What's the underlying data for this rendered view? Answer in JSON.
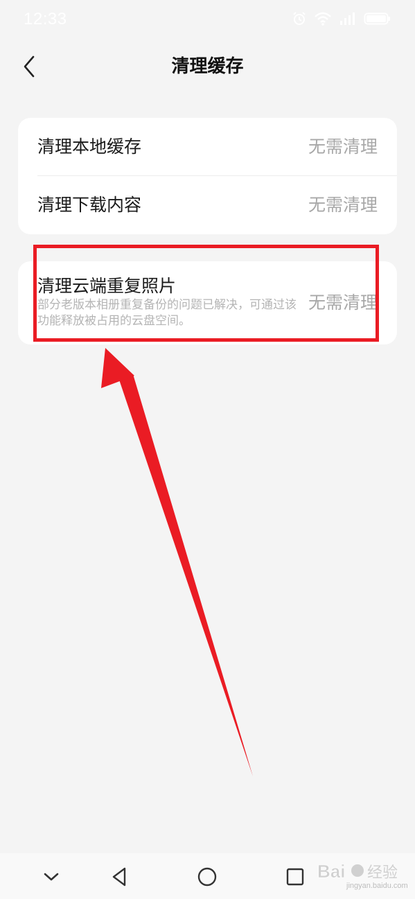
{
  "status_bar": {
    "time": "12:33",
    "icons": [
      "alarm-icon",
      "wifi-icon",
      "signal-icon",
      "battery-icon"
    ]
  },
  "header": {
    "title": "清理缓存",
    "back_icon": "chevron-left-icon"
  },
  "cache_items": [
    {
      "label": "清理本地缓存",
      "status": "无需清理"
    },
    {
      "label": "清理下载内容",
      "status": "无需清理"
    }
  ],
  "cloud_item": {
    "label": "清理云端重复照片",
    "description": "部分老版本相册重复备份的问题已解决，可通过该功能释放被占用的云盘空间。",
    "status": "无需清理"
  },
  "nav_bar": {
    "icons": [
      "chevron-down-icon",
      "back-triangle-icon",
      "home-circle-icon",
      "recents-square-icon"
    ]
  },
  "watermark": {
    "text": "jingyan.baidu.com"
  },
  "colors": {
    "background": "#f4f4f4",
    "card": "#ffffff",
    "primary_text": "#1a1a1a",
    "secondary_text": "#a8a8a8",
    "annotation_red": "#ea1c24"
  }
}
